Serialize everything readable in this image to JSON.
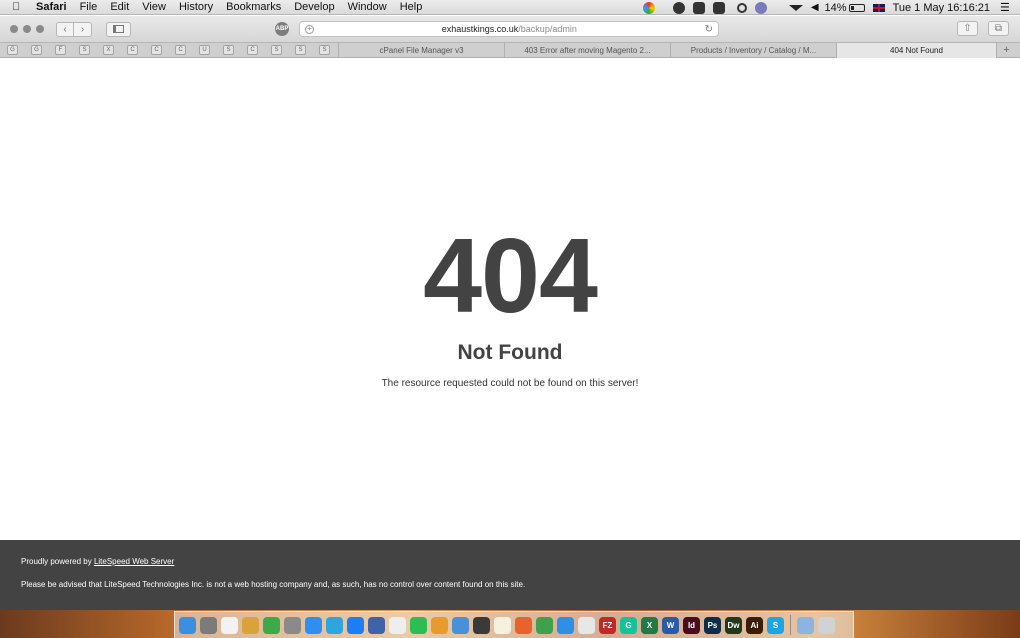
{
  "menubar": {
    "apple_icon": "apple-icon",
    "app_name": "Safari",
    "menus": [
      "File",
      "Edit",
      "View",
      "History",
      "Bookmarks",
      "Develop",
      "Window",
      "Help"
    ],
    "battery_percent": "14%",
    "clock": "Tue 1 May  16:16:21"
  },
  "toolbar": {
    "abp_label": "ABP",
    "url_host": "exhaustkings.co.uk",
    "url_path": "/backup/admin"
  },
  "tabbar": {
    "pinned_tabs": [
      "G",
      "G",
      "F",
      "S",
      "X",
      "C",
      "C",
      "C",
      "U",
      "S",
      "C",
      "S",
      "S",
      "S"
    ],
    "tabs": [
      {
        "label": "cPanel File Manager v3",
        "active": false
      },
      {
        "label": "403 Error after moving Magento 2...",
        "active": false
      },
      {
        "label": "Products / Inventory / Catalog / M...",
        "active": false
      },
      {
        "label": "404 Not Found",
        "active": true
      }
    ],
    "add_label": "+"
  },
  "page": {
    "code": "404",
    "title": "Not Found",
    "description": "The resource requested could not be found on this server!"
  },
  "footer": {
    "powered_prefix": "Proudly powered by ",
    "powered_link": "LiteSpeed Web Server",
    "notice": "Please be advised that LiteSpeed Technologies Inc. is not a web hosting company and, as such, has no control over content found on this site."
  },
  "dock": {
    "icons": [
      {
        "name": "finder-icon",
        "color": "#3b8fe0",
        "label": ""
      },
      {
        "name": "system-preferences-icon",
        "color": "#7b7b7b",
        "label": ""
      },
      {
        "name": "calendar-icon",
        "color": "#f2f2f2",
        "label": ""
      },
      {
        "name": "notes-app-icon",
        "color": "#d9a23a",
        "label": ""
      },
      {
        "name": "vpn-shield-icon",
        "color": "#3caa48",
        "label": ""
      },
      {
        "name": "rocket-app-icon",
        "color": "#8a8a8a",
        "label": ""
      },
      {
        "name": "app-store-icon",
        "color": "#2f8ef0",
        "label": ""
      },
      {
        "name": "telegram-icon",
        "color": "#2ea6dd",
        "label": ""
      },
      {
        "name": "messenger-icon",
        "color": "#1c7ef2",
        "label": ""
      },
      {
        "name": "image-app-icon",
        "color": "#4062a8",
        "label": ""
      },
      {
        "name": "document-app-icon",
        "color": "#eeeeee",
        "label": ""
      },
      {
        "name": "spotify-icon",
        "color": "#2dbd55",
        "label": ""
      },
      {
        "name": "sublime-text-icon",
        "color": "#e89b2d",
        "label": ""
      },
      {
        "name": "folder-app-icon",
        "color": "#4a90d9",
        "label": ""
      },
      {
        "name": "clapper-app-icon",
        "color": "#3a3a3a",
        "label": ""
      },
      {
        "name": "text-editor-icon",
        "color": "#f4f1e1",
        "label": ""
      },
      {
        "name": "firefox-icon",
        "color": "#e8622b",
        "label": ""
      },
      {
        "name": "chrome-icon",
        "color": "#41a04c",
        "label": ""
      },
      {
        "name": "safari-icon",
        "color": "#2d8fe6",
        "label": ""
      },
      {
        "name": "itunes-icon",
        "color": "#e7e7e7",
        "label": ""
      },
      {
        "name": "filezilla-icon",
        "color": "#bf2a26",
        "label": "FZ"
      },
      {
        "name": "grammarly-icon",
        "color": "#15c39a",
        "label": "G"
      },
      {
        "name": "excel-icon",
        "color": "#1f7a43",
        "label": "X"
      },
      {
        "name": "word-icon",
        "color": "#2b5aa6",
        "label": "W"
      },
      {
        "name": "indesign-icon",
        "color": "#4a0d1f",
        "label": "Id"
      },
      {
        "name": "photoshop-icon",
        "color": "#0f2c4a",
        "label": "Ps"
      },
      {
        "name": "dreamweaver-icon",
        "color": "#1e3a1a",
        "label": "Dw"
      },
      {
        "name": "illustrator-icon",
        "color": "#3a1d05",
        "label": "Ai"
      },
      {
        "name": "skype-icon",
        "color": "#1fa5e6",
        "label": "S"
      },
      {
        "name": "downloads-folder-icon",
        "color": "#8bb4e0",
        "label": ""
      },
      {
        "name": "trash-icon",
        "color": "#cfd3d6",
        "label": ""
      }
    ]
  }
}
